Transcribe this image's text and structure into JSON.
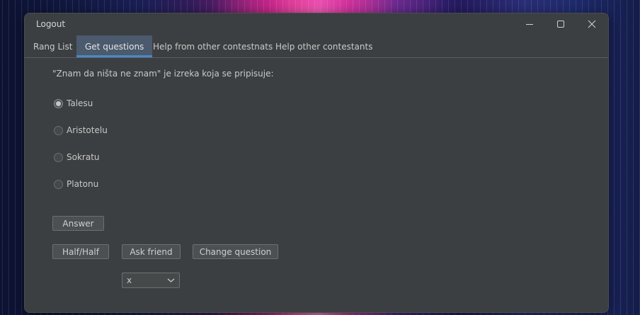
{
  "window": {
    "title": "Logout",
    "controls": {
      "minimize": "minimize-icon",
      "maximize": "maximize-icon",
      "close": "close-icon"
    }
  },
  "tabs": [
    {
      "label": "Rang List",
      "active": false
    },
    {
      "label": "Get questions",
      "active": true
    },
    {
      "label": "Help from other contestnats",
      "active": false
    },
    {
      "label": "Help other contestants",
      "active": false
    }
  ],
  "question": {
    "text": "\"Znam da ništa ne znam\" je izreka koja se pripisuje:",
    "options": [
      {
        "label": "Talesu",
        "selected": true
      },
      {
        "label": "Aristotelu",
        "selected": false
      },
      {
        "label": "Sokratu",
        "selected": false
      },
      {
        "label": "Platonu",
        "selected": false
      }
    ]
  },
  "actions": {
    "answer_label": "Answer",
    "half_half_label": "Half/Half",
    "ask_friend_label": "Ask friend",
    "change_question_label": "Change question"
  },
  "friend_select": {
    "selected_value": "x"
  },
  "colors": {
    "window_bg": "#3c3f41",
    "tab_active_bg": "#4b5a6d",
    "tab_active_underline": "#4a88c7",
    "button_bg": "#4c5052",
    "text": "#c8c8c8"
  }
}
